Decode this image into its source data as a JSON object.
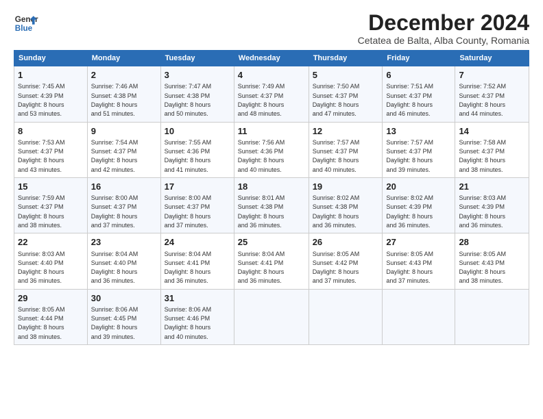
{
  "logo": {
    "line1": "General",
    "line2": "Blue"
  },
  "title": "December 2024",
  "subtitle": "Cetatea de Balta, Alba County, Romania",
  "headers": [
    "Sunday",
    "Monday",
    "Tuesday",
    "Wednesday",
    "Thursday",
    "Friday",
    "Saturday"
  ],
  "weeks": [
    [
      {
        "day": "1",
        "info": "Sunrise: 7:45 AM\nSunset: 4:39 PM\nDaylight: 8 hours\nand 53 minutes."
      },
      {
        "day": "2",
        "info": "Sunrise: 7:46 AM\nSunset: 4:38 PM\nDaylight: 8 hours\nand 51 minutes."
      },
      {
        "day": "3",
        "info": "Sunrise: 7:47 AM\nSunset: 4:38 PM\nDaylight: 8 hours\nand 50 minutes."
      },
      {
        "day": "4",
        "info": "Sunrise: 7:49 AM\nSunset: 4:37 PM\nDaylight: 8 hours\nand 48 minutes."
      },
      {
        "day": "5",
        "info": "Sunrise: 7:50 AM\nSunset: 4:37 PM\nDaylight: 8 hours\nand 47 minutes."
      },
      {
        "day": "6",
        "info": "Sunrise: 7:51 AM\nSunset: 4:37 PM\nDaylight: 8 hours\nand 46 minutes."
      },
      {
        "day": "7",
        "info": "Sunrise: 7:52 AM\nSunset: 4:37 PM\nDaylight: 8 hours\nand 44 minutes."
      }
    ],
    [
      {
        "day": "8",
        "info": "Sunrise: 7:53 AM\nSunset: 4:37 PM\nDaylight: 8 hours\nand 43 minutes."
      },
      {
        "day": "9",
        "info": "Sunrise: 7:54 AM\nSunset: 4:37 PM\nDaylight: 8 hours\nand 42 minutes."
      },
      {
        "day": "10",
        "info": "Sunrise: 7:55 AM\nSunset: 4:36 PM\nDaylight: 8 hours\nand 41 minutes."
      },
      {
        "day": "11",
        "info": "Sunrise: 7:56 AM\nSunset: 4:36 PM\nDaylight: 8 hours\nand 40 minutes."
      },
      {
        "day": "12",
        "info": "Sunrise: 7:57 AM\nSunset: 4:37 PM\nDaylight: 8 hours\nand 40 minutes."
      },
      {
        "day": "13",
        "info": "Sunrise: 7:57 AM\nSunset: 4:37 PM\nDaylight: 8 hours\nand 39 minutes."
      },
      {
        "day": "14",
        "info": "Sunrise: 7:58 AM\nSunset: 4:37 PM\nDaylight: 8 hours\nand 38 minutes."
      }
    ],
    [
      {
        "day": "15",
        "info": "Sunrise: 7:59 AM\nSunset: 4:37 PM\nDaylight: 8 hours\nand 38 minutes."
      },
      {
        "day": "16",
        "info": "Sunrise: 8:00 AM\nSunset: 4:37 PM\nDaylight: 8 hours\nand 37 minutes."
      },
      {
        "day": "17",
        "info": "Sunrise: 8:00 AM\nSunset: 4:37 PM\nDaylight: 8 hours\nand 37 minutes."
      },
      {
        "day": "18",
        "info": "Sunrise: 8:01 AM\nSunset: 4:38 PM\nDaylight: 8 hours\nand 36 minutes."
      },
      {
        "day": "19",
        "info": "Sunrise: 8:02 AM\nSunset: 4:38 PM\nDaylight: 8 hours\nand 36 minutes."
      },
      {
        "day": "20",
        "info": "Sunrise: 8:02 AM\nSunset: 4:39 PM\nDaylight: 8 hours\nand 36 minutes."
      },
      {
        "day": "21",
        "info": "Sunrise: 8:03 AM\nSunset: 4:39 PM\nDaylight: 8 hours\nand 36 minutes."
      }
    ],
    [
      {
        "day": "22",
        "info": "Sunrise: 8:03 AM\nSunset: 4:40 PM\nDaylight: 8 hours\nand 36 minutes."
      },
      {
        "day": "23",
        "info": "Sunrise: 8:04 AM\nSunset: 4:40 PM\nDaylight: 8 hours\nand 36 minutes."
      },
      {
        "day": "24",
        "info": "Sunrise: 8:04 AM\nSunset: 4:41 PM\nDaylight: 8 hours\nand 36 minutes."
      },
      {
        "day": "25",
        "info": "Sunrise: 8:04 AM\nSunset: 4:41 PM\nDaylight: 8 hours\nand 36 minutes."
      },
      {
        "day": "26",
        "info": "Sunrise: 8:05 AM\nSunset: 4:42 PM\nDaylight: 8 hours\nand 37 minutes."
      },
      {
        "day": "27",
        "info": "Sunrise: 8:05 AM\nSunset: 4:43 PM\nDaylight: 8 hours\nand 37 minutes."
      },
      {
        "day": "28",
        "info": "Sunrise: 8:05 AM\nSunset: 4:43 PM\nDaylight: 8 hours\nand 38 minutes."
      }
    ],
    [
      {
        "day": "29",
        "info": "Sunrise: 8:05 AM\nSunset: 4:44 PM\nDaylight: 8 hours\nand 38 minutes."
      },
      {
        "day": "30",
        "info": "Sunrise: 8:06 AM\nSunset: 4:45 PM\nDaylight: 8 hours\nand 39 minutes."
      },
      {
        "day": "31",
        "info": "Sunrise: 8:06 AM\nSunset: 4:46 PM\nDaylight: 8 hours\nand 40 minutes."
      },
      {
        "day": "",
        "info": ""
      },
      {
        "day": "",
        "info": ""
      },
      {
        "day": "",
        "info": ""
      },
      {
        "day": "",
        "info": ""
      }
    ]
  ]
}
